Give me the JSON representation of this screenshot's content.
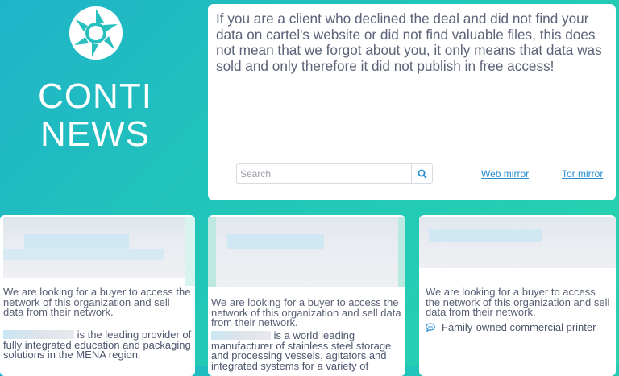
{
  "brand": {
    "title": "CONTI\nNEWS",
    "logo_icon": "camera-aperture-icon"
  },
  "notice": {
    "text": "If you are a client who declined the deal and did not find your data on cartel's website or did not find valuable files, this does not mean that we forgot about you, it only means that data was sold and only therefore it did not publish in free access!"
  },
  "search": {
    "placeholder": "Search",
    "icon": "search-icon"
  },
  "links": {
    "web_mirror": "Web mirror",
    "tor_mirror": "Tor mirror"
  },
  "cards": [
    {
      "description": "We are looking for a buyer to access the network of this organization and sell data from their network.",
      "subtitle_tail": "is the leading provider of fully integrated education and packaging solutions in the MENA region."
    },
    {
      "description": "We are looking for a buyer to access the network of this organization and sell data from their network.",
      "subtitle_tail": "is a world leading manufacturer of stainless steel storage and processing vessels, agitators and integrated systems for a variety of"
    },
    {
      "description": "We are looking for a buyer to access the network of this organization and sell data from their network.",
      "subtitle": "Family-owned commercial printer",
      "subtitle_icon": "chat-bubble-icon"
    }
  ],
  "colors": {
    "background_start": "#1fb3c9",
    "background_end": "#27d4ad",
    "link": "#2a8fd0",
    "text": "#5c6379"
  }
}
